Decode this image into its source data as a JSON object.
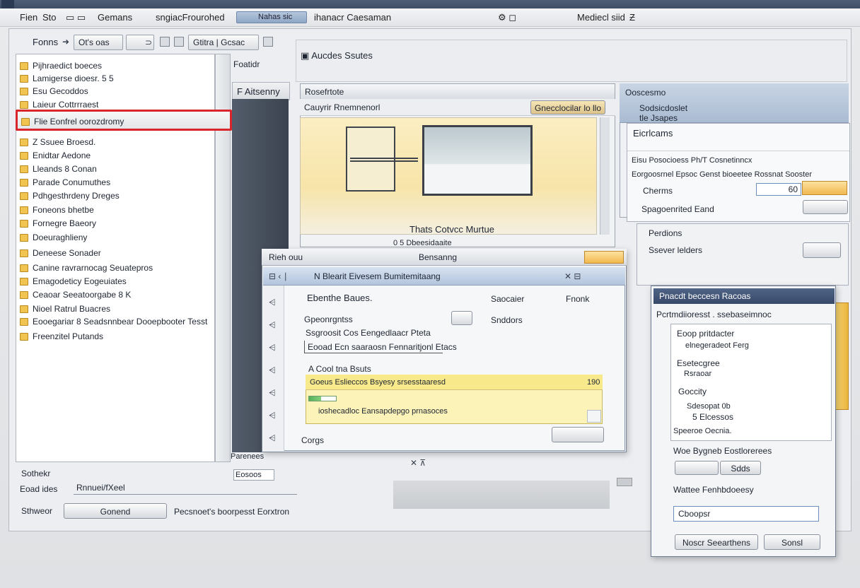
{
  "menubar": {
    "items": [
      "Fien",
      "Sto",
      "Gemans",
      "sngiacFrourohed",
      "ihanacr Caesaman",
      "Mediecl siid"
    ],
    "search_value": "Nahas   sic"
  },
  "toolbar": {
    "label1": "Fonns",
    "field_value": "Ot's oas",
    "btn_label": "Gtitra",
    "btn_label2": "Gcsac"
  },
  "panel_headers": {
    "tree_caption": "Foatidr",
    "column_caption": "F Aitsenny",
    "preview_window": "Aucdes Ssutes",
    "preview_title": "Rosefrtote",
    "preview_toolbar_left": "Cauyrir Rnemnenorl",
    "preview_toolbar_btn": "Gnecclocilar lo llo"
  },
  "tree": {
    "items": [
      "Pijhraedict boeces",
      "Lamigerse dioesr. 5 5",
      "Esu Gecoddos",
      "Laieur Cottrrraest",
      "Flie Eonfrel oorozdromy",
      "Z Ssuee Broesd.",
      "Enidtar Aedone",
      "Lleands 8 Conan",
      "Parade Conumuthes",
      "Pdhgesthrdeny Dreges",
      "Foneons bhetbe",
      "Fornegre Baeory",
      "Doeuraghlieny",
      "Deneese Sonader",
      "Canine ravrarnocag Seuatepros",
      "Emagodeticy Eogeuiates",
      "Ceaoar Seeatoorgabe 8 K",
      "Nioel Ratrul Buacres",
      "Eooegariar  8 Seadsnnbear Dooepbooter Tesst",
      "Freenzitel Putands"
    ]
  },
  "bottom_left": {
    "label1": "Sothekr",
    "label2": "Eoad ides",
    "label3": "Sthweor",
    "field_value": "Rnnuei/fXeel",
    "button_label": "Gonend",
    "status": "Pecsnoet's boorpesst Eorxtron",
    "small_label": "Parenees",
    "small_field": "Eosoos"
  },
  "preview": {
    "caption": "Thats Cotvcc Murtue",
    "caption2": "0 5  Dbeesidaaite"
  },
  "dialog": {
    "title_left": "Rieh ouu",
    "title_center": "Bensanng",
    "inner_title": "N Blearit Eivesem Bumitemitaang",
    "row1_left": "Ebenthe Baues.",
    "row1_mid": "Saocaier",
    "row1_right": "Fnonk",
    "row2_left": "Gpeonrgntss",
    "row2_right": "Snddors",
    "row3": "Ssgroosit  Cos Eengedlaacr Pteta",
    "row4": "Eooad Ecn saaraosn Fennaritjonl Etacs",
    "section": "A Cool tna Bsuts",
    "list_row1": "Goeus  Eslieccos Bsyesy srsesstaaresd",
    "list_row1_value": "190",
    "list_row2": "ioshecadloc Eansapdepgo prnasoces",
    "progress": 0.45,
    "footer_left": "Corgs"
  },
  "right_panel": {
    "title": "Ooscesmo",
    "row1": "Sodsicdoslet",
    "row2": "tle Jsapes",
    "row3": "Eicrlcams",
    "row4": "Eisu Posocioess  Ph/T Cosnetinncx",
    "row5": "Eorgoosrnel Epsoc  Genst bioeetee   Rossnat Sooster",
    "row6": "Cherms",
    "row6_field": "60",
    "row7": "Spagoenrited Eand"
  },
  "right_panel2": {
    "row1": "Perdions",
    "row2": "Ssever lelders"
  },
  "right_dialog": {
    "title": "Pnacdt beccesn  Racoas",
    "header_row": "Pcrtmdiioresst . ssebaseimnoc",
    "items": [
      "Eoop pritdacter",
      "elnegeradeot Ferg",
      "Esetecgree",
      "Rsraoar",
      "Goccity",
      "Sdesopat  0b",
      "5 Elcessos",
      "Speeroe Oecnia."
    ],
    "row_a": "Woe Bygneb Eostlorerees",
    "field_b": "Sdds",
    "row_c": "Wattee Fenhbdoeesy",
    "input_value": "Cboopsr",
    "button1": "Noscr Seearthens",
    "button2": "Sonsl"
  },
  "icons": [
    "magnifier-icon",
    "gear-icon",
    "folder-icon",
    "close-icon",
    "chevron-down-icon",
    "scroll-arrow-icon",
    "window-icon"
  ]
}
